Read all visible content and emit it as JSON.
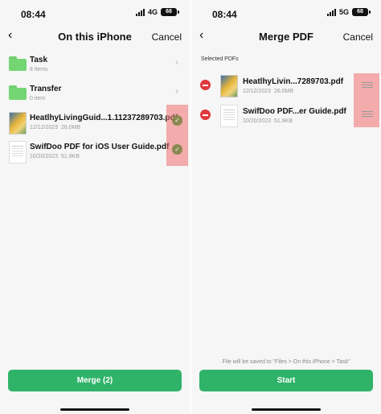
{
  "left": {
    "status": {
      "time": "08:44",
      "network": "4G",
      "battery": "68"
    },
    "nav": {
      "back": "‹",
      "title": "On this iPhone",
      "cancel": "Cancel"
    },
    "folders": [
      {
        "name": "Task",
        "sub": "8 items"
      },
      {
        "name": "Transfer",
        "sub": "0 item"
      }
    ],
    "files": [
      {
        "name": "HeatlhyLivingGuid...1.11237289703.pdf",
        "date": "12/12/2023",
        "size": "26.0MB",
        "checked": true
      },
      {
        "name": "SwifDoo PDF for iOS User Guide.pdf",
        "date": "10/20/2023",
        "size": "51.9KB",
        "checked": true
      }
    ],
    "button": "Merge (2)"
  },
  "right": {
    "status": {
      "time": "08:44",
      "network": "5G",
      "battery": "68"
    },
    "nav": {
      "back": "‹",
      "title": "Merge PDF",
      "cancel": "Cancel"
    },
    "section_label": "Selected PDFs",
    "files": [
      {
        "name": "HeatlhyLivin...7289703.pdf",
        "date": "12/12/2023",
        "size": "26.0MB"
      },
      {
        "name": "SwifDoo PDF...er Guide.pdf",
        "date": "10/20/2023",
        "size": "51.9KB"
      }
    ],
    "footnote": "File will be saved to \"Files > On this iPhone > Task\"",
    "button": "Start"
  },
  "colors": {
    "accent": "#2fb369",
    "folder": "#73d673",
    "remove": "#e0393e",
    "highlight": "#f06e6e"
  }
}
